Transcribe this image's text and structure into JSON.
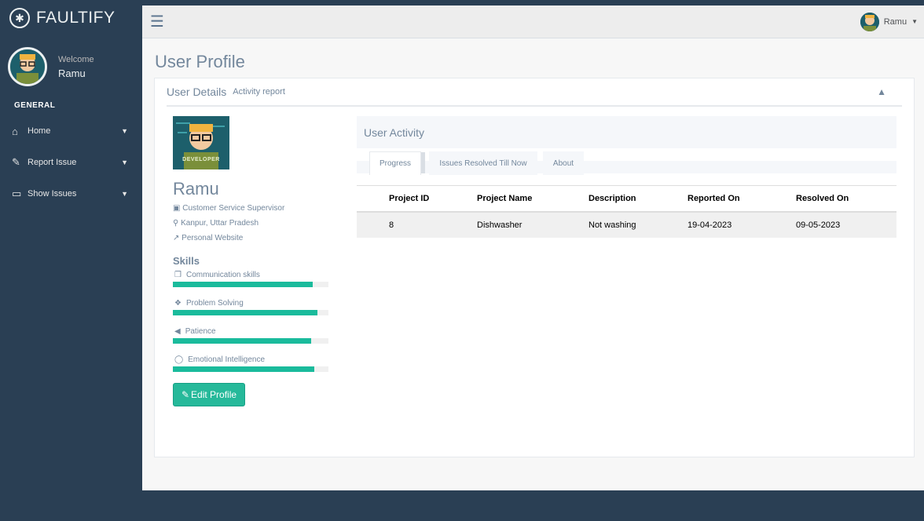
{
  "brand": {
    "name": "FAULTIFY"
  },
  "sidebar": {
    "welcome": "Welcome",
    "user_name": "Ramu",
    "section": "GENERAL",
    "items": [
      {
        "label": "Home",
        "icon": "home-icon"
      },
      {
        "label": "Report Issue",
        "icon": "edit-icon"
      },
      {
        "label": "Show Issues",
        "icon": "desktop-icon"
      }
    ]
  },
  "topbar": {
    "user": "Ramu"
  },
  "page": {
    "title": "User Profile"
  },
  "panel": {
    "title": "User Details",
    "subtitle": "Activity report"
  },
  "profile": {
    "avatar_label": "DEVELOPER",
    "name": "Ramu",
    "role": "Customer Service Supervisor",
    "location": "Kanpur, Uttar Pradesh",
    "website": "Personal Website",
    "skills_title": "Skills",
    "skills": [
      {
        "label": "Communication skills",
        "level": 0.9
      },
      {
        "label": "Problem Solving",
        "level": 0.93
      },
      {
        "label": "Patience",
        "level": 0.89
      },
      {
        "label": "Emotional Intelligence",
        "level": 0.91
      }
    ],
    "edit_label": "Edit Profile"
  },
  "activity": {
    "title": "User Activity",
    "tabs": [
      "Progress",
      "Issues Resolved Till Now",
      "About"
    ],
    "active_tab": "Progress",
    "columns": [
      "Project ID",
      "Project Name",
      "Description",
      "Reported On",
      "Resolved On"
    ],
    "rows": [
      [
        "8",
        "Dishwasher",
        "Not washing",
        "19-04-2023",
        "09-05-2023"
      ]
    ]
  },
  "colors": {
    "sidebar": "#2a3f54",
    "accent": "#1abb9c",
    "button": "#26b99a"
  }
}
